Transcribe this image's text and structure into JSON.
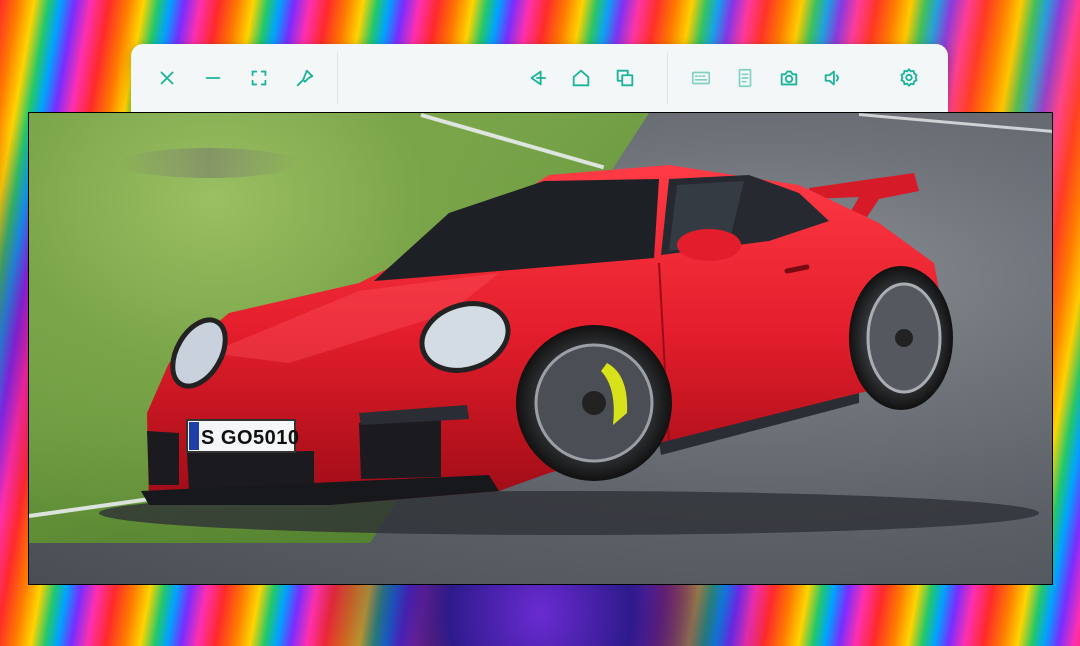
{
  "colors": {
    "toolbar_bg": "#f4f7f8",
    "icon_accent": "#1bb39a",
    "icon_muted": "#7fd2c2",
    "car_red": "#e31d2b",
    "caliper_yellow": "#d7e21a"
  },
  "toolbar": {
    "left_icons": [
      "close-icon",
      "minimize-icon",
      "fullscreen-icon",
      "pin-icon"
    ],
    "nav_icons": [
      "back-icon",
      "home-icon",
      "recent-apps-icon"
    ],
    "tool_icons": [
      "keyboard-icon",
      "document-icon",
      "screenshot-icon",
      "volume-icon"
    ],
    "settings_icon": "gear-icon"
  },
  "viewer": {
    "license_plate": "S GO5010"
  }
}
